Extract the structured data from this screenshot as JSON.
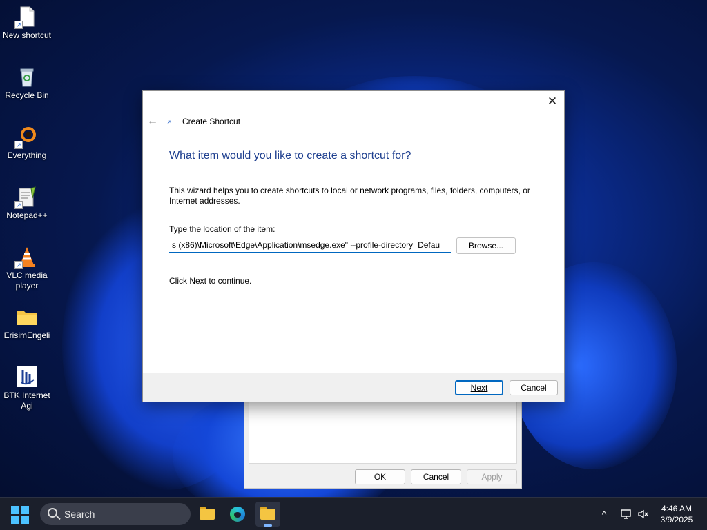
{
  "desktop_icons": [
    {
      "label": "New shortcut",
      "icon": "file-shortcut-icon"
    },
    {
      "label": "Recycle Bin",
      "icon": "recycle-bin-icon"
    },
    {
      "label": "Everything",
      "icon": "everything-search-icon"
    },
    {
      "label": "Notepad++",
      "icon": "notepadpp-icon"
    },
    {
      "label": "VLC media player",
      "icon": "vlc-cone-icon"
    },
    {
      "label": "ErisimEngeli",
      "icon": "folder-icon"
    },
    {
      "label": "BTK Internet Agi",
      "icon": "btk-logo-icon"
    }
  ],
  "wizard": {
    "title": "Create Shortcut",
    "heading": "What item would you like to create a shortcut for?",
    "description": "This wizard helps you to create shortcuts to local or network programs, files, folders, computers, or Internet addresses.",
    "location_label": "Type the location of the item:",
    "location_value": "s (x86)\\Microsoft\\Edge\\Application\\msedge.exe\" --profile-directory=Defau",
    "browse_label": "Browse...",
    "hint": "Click Next to continue.",
    "next_label": "Next",
    "cancel_label": "Cancel"
  },
  "properties_window": {
    "ok_label": "OK",
    "cancel_label": "Cancel",
    "apply_label": "Apply"
  },
  "taskbar": {
    "search_placeholder": "Search",
    "time": "4:46 AM",
    "date": "3/9/2025",
    "accent": "#4cc2ff"
  }
}
